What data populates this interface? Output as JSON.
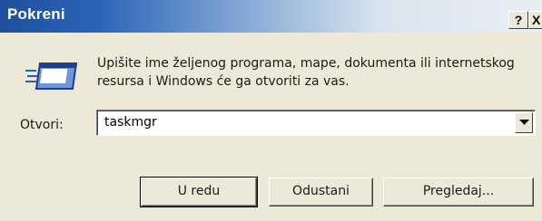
{
  "window": {
    "title": "Pokreni",
    "help_label": "?",
    "close_label": "X"
  },
  "dialog": {
    "description": "Upišite ime željenog programa, mape, dokumenta ili internetskog resursa i Windows će ga otvoriti za vas.",
    "open_label": "Otvori:",
    "open_value": "taskmgr"
  },
  "buttons": {
    "ok_label": "U redu",
    "cancel_label": "Odustani",
    "browse_label": "Pregledaj..."
  },
  "colors": {
    "titlebar_start": "#1e4f9c",
    "titlebar_end": "#e8eef5",
    "dialog_bg": "#ece9d8"
  },
  "icons": {
    "run": "run-program-icon",
    "dropdown": "chevron-down-icon"
  }
}
